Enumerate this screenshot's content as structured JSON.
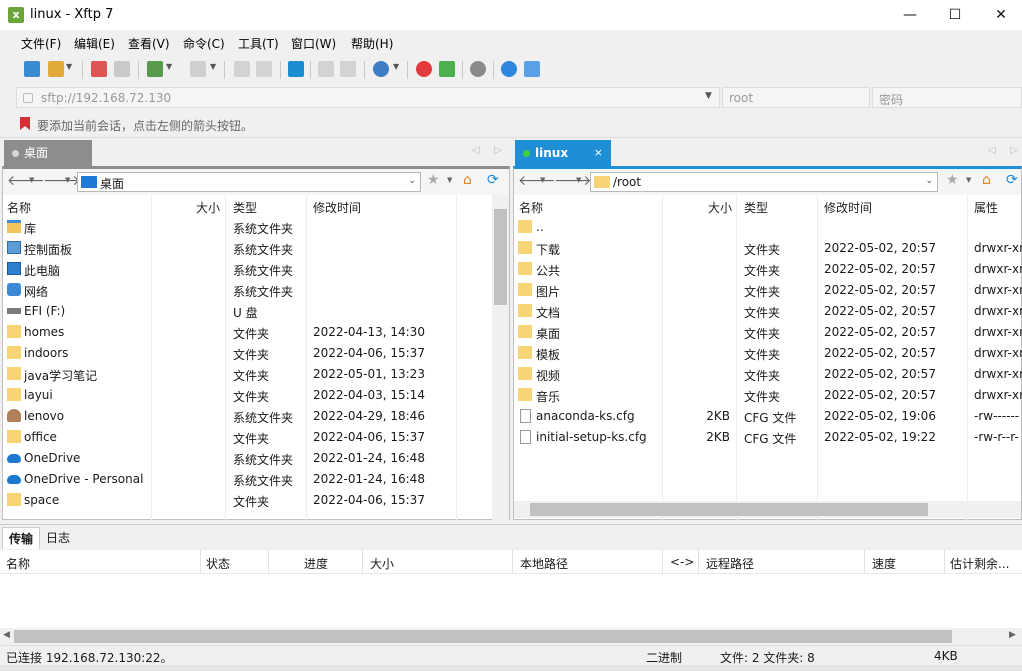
{
  "window": {
    "title": "linux - Xftp 7",
    "icon_letter": "x",
    "min_glyph": "—",
    "max_glyph": "☐",
    "close_glyph": "✕"
  },
  "menu": [
    "文件(F)",
    "编辑(E)",
    "查看(V)",
    "命令(C)",
    "工具(T)",
    "窗口(W)",
    "帮助(H)"
  ],
  "address": {
    "host": "sftp://192.168.72.130",
    "user_placeholder": "root",
    "password_placeholder": "密码"
  },
  "hint": "要添加当前会话，点击左侧的箭头按钮。",
  "tabs": {
    "left": "桌面",
    "right": "linux",
    "close": "×",
    "prev": "◁",
    "next": "▷"
  },
  "left_pane": {
    "path": "桌面",
    "columns": {
      "name": "名称",
      "size": "大小",
      "type": "类型",
      "modified": "修改时间"
    },
    "rows": [
      {
        "name": "库",
        "size": "",
        "type": "系统文件夹",
        "modified": "",
        "icon": "library-icon"
      },
      {
        "name": "控制面板",
        "size": "",
        "type": "系统文件夹",
        "modified": "",
        "icon": "control-panel-icon"
      },
      {
        "name": "此电脑",
        "size": "",
        "type": "系统文件夹",
        "modified": "",
        "icon": "computer-icon"
      },
      {
        "name": "网络",
        "size": "",
        "type": "系统文件夹",
        "modified": "",
        "icon": "network-icon"
      },
      {
        "name": "EFI (F:)",
        "size": "",
        "type": "U 盘",
        "modified": "",
        "icon": "usb-drive-icon"
      },
      {
        "name": "homes",
        "size": "",
        "type": "文件夹",
        "modified": "2022-04-13, 14:30",
        "icon": "folder-icon"
      },
      {
        "name": "indoors",
        "size": "",
        "type": "文件夹",
        "modified": "2022-04-06, 15:37",
        "icon": "folder-icon"
      },
      {
        "name": "java学习笔记",
        "size": "",
        "type": "文件夹",
        "modified": "2022-05-01, 13:23",
        "icon": "folder-icon"
      },
      {
        "name": "layui",
        "size": "",
        "type": "文件夹",
        "modified": "2022-04-03, 15:14",
        "icon": "folder-icon"
      },
      {
        "name": "lenovo",
        "size": "",
        "type": "系统文件夹",
        "modified": "2022-04-29, 18:46",
        "icon": "user-folder-icon"
      },
      {
        "name": "office",
        "size": "",
        "type": "文件夹",
        "modified": "2022-04-06, 15:37",
        "icon": "folder-icon"
      },
      {
        "name": "OneDrive",
        "size": "",
        "type": "系统文件夹",
        "modified": "2022-01-24, 16:48",
        "icon": "onedrive-icon"
      },
      {
        "name": "OneDrive - Personal",
        "size": "",
        "type": "系统文件夹",
        "modified": "2022-01-24, 16:48",
        "icon": "onedrive-icon"
      },
      {
        "name": "space",
        "size": "",
        "type": "文件夹",
        "modified": "2022-04-06, 15:37",
        "icon": "folder-icon"
      }
    ]
  },
  "right_pane": {
    "path": "/root",
    "columns": {
      "name": "名称",
      "size": "大小",
      "type": "类型",
      "modified": "修改时间",
      "attrs": "属性"
    },
    "rows": [
      {
        "name": "..",
        "size": "",
        "type": "",
        "modified": "",
        "attrs": "",
        "icon": "folder-icon"
      },
      {
        "name": "下载",
        "size": "",
        "type": "文件夹",
        "modified": "2022-05-02, 20:57",
        "attrs": "drwxr-xr",
        "icon": "folder-icon"
      },
      {
        "name": "公共",
        "size": "",
        "type": "文件夹",
        "modified": "2022-05-02, 20:57",
        "attrs": "drwxr-xr",
        "icon": "folder-icon"
      },
      {
        "name": "图片",
        "size": "",
        "type": "文件夹",
        "modified": "2022-05-02, 20:57",
        "attrs": "drwxr-xr",
        "icon": "folder-icon"
      },
      {
        "name": "文档",
        "size": "",
        "type": "文件夹",
        "modified": "2022-05-02, 20:57",
        "attrs": "drwxr-xr",
        "icon": "folder-icon"
      },
      {
        "name": "桌面",
        "size": "",
        "type": "文件夹",
        "modified": "2022-05-02, 20:57",
        "attrs": "drwxr-xr",
        "icon": "folder-icon"
      },
      {
        "name": "模板",
        "size": "",
        "type": "文件夹",
        "modified": "2022-05-02, 20:57",
        "attrs": "drwxr-xr",
        "icon": "folder-icon"
      },
      {
        "name": "视频",
        "size": "",
        "type": "文件夹",
        "modified": "2022-05-02, 20:57",
        "attrs": "drwxr-xr",
        "icon": "folder-icon"
      },
      {
        "name": "音乐",
        "size": "",
        "type": "文件夹",
        "modified": "2022-05-02, 20:57",
        "attrs": "drwxr-xr",
        "icon": "folder-icon"
      },
      {
        "name": "anaconda-ks.cfg",
        "size": "2KB",
        "type": "CFG 文件",
        "modified": "2022-05-02, 19:06",
        "attrs": "-rw------",
        "icon": "file-icon"
      },
      {
        "name": "initial-setup-ks.cfg",
        "size": "2KB",
        "type": "CFG 文件",
        "modified": "2022-05-02, 19:22",
        "attrs": "-rw-r--r-",
        "icon": "file-icon"
      }
    ]
  },
  "transfer": {
    "tabs": [
      "传输",
      "日志"
    ],
    "columns": [
      "名称",
      "状态",
      "进度",
      "大小",
      "本地路径",
      "<->",
      "远程路径",
      "速度",
      "估计剩余..."
    ]
  },
  "status": {
    "connected": "已连接 192.168.72.130:22。",
    "mode": "二进制",
    "counts": "文件: 2  文件夹: 8",
    "size": "4KB"
  },
  "colors": {
    "remote_tab": "#1e8fd6",
    "local_tab": "#8d8d8d",
    "folder": "#f7d476"
  }
}
